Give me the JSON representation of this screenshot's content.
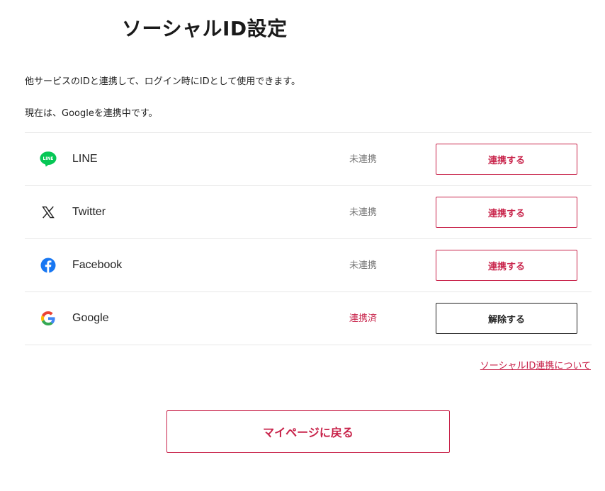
{
  "page": {
    "title": "ソーシャルID設定",
    "description": "他サービスのIDと連携して、ログイン時にIDとして使用できます。",
    "current_status": "現在は、Googleを連携中です。"
  },
  "accounts": [
    {
      "name": "LINE",
      "icon": "line-icon",
      "status": "未連携",
      "action": "連携する"
    },
    {
      "name": "Twitter",
      "icon": "x-logo-icon",
      "status": "未連携",
      "action": "連携する"
    },
    {
      "name": "Facebook",
      "icon": "facebook-icon",
      "status": "未連携",
      "action": "連携する"
    },
    {
      "name": "Google",
      "icon": "google-icon",
      "status": "連携済",
      "action": "解除する"
    }
  ],
  "about_link": "ソーシャルID連携について",
  "back_button": "マイページに戻る",
  "colors": {
    "accent": "#c8234a",
    "line_green": "#06c755",
    "facebook_blue": "#1877f2",
    "text": "#222222",
    "muted": "#777777",
    "divider": "#e8e8e8"
  }
}
